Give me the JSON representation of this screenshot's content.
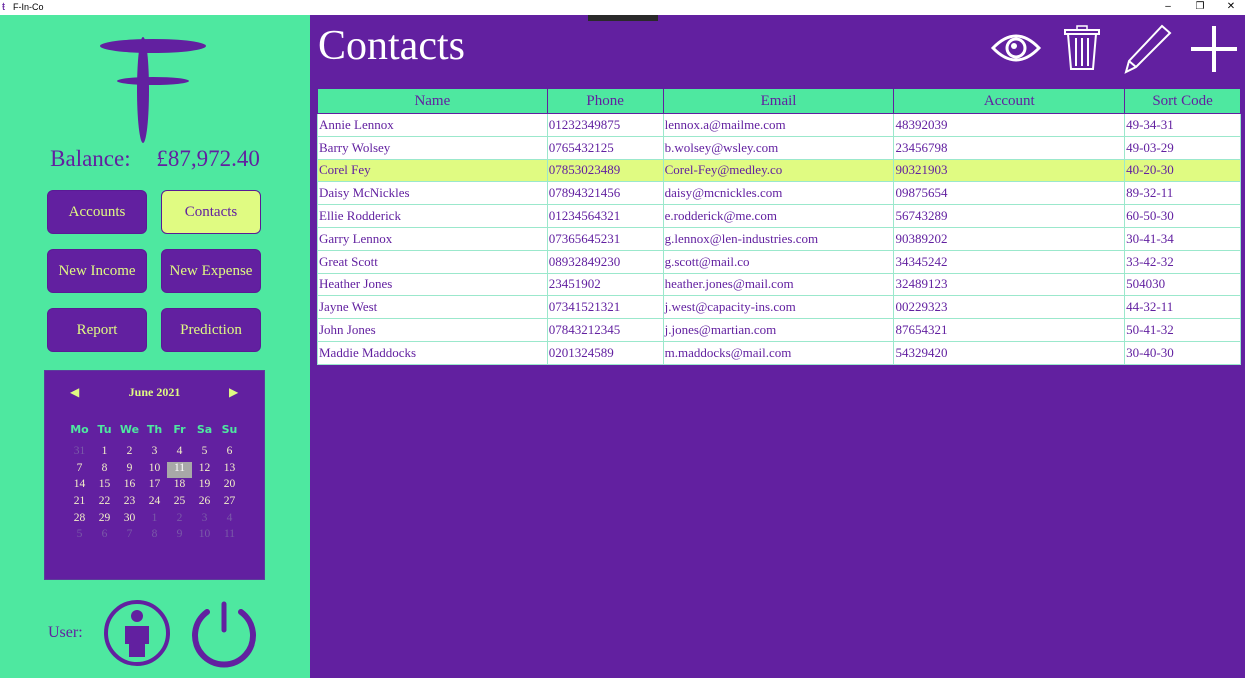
{
  "window": {
    "title": "F-In-Co"
  },
  "sidebar": {
    "balance_label": "Balance:",
    "balance_value": "£87,972.40",
    "buttons": [
      {
        "label": "Accounts",
        "active": false
      },
      {
        "label": "Contacts",
        "active": true
      },
      {
        "label": "New Income",
        "active": false
      },
      {
        "label": "New Expense",
        "active": false
      },
      {
        "label": "Report",
        "active": false
      },
      {
        "label": "Prediction",
        "active": false
      }
    ],
    "calendar": {
      "month": "June 2021",
      "days_of_week": [
        "Mo",
        "Tu",
        "We",
        "Th",
        "Fr",
        "Sa",
        "Su"
      ],
      "selected": "11",
      "weeks": [
        [
          "31",
          "1",
          "2",
          "3",
          "4",
          "5",
          "6"
        ],
        [
          "7",
          "8",
          "9",
          "10",
          "11",
          "12",
          "13"
        ],
        [
          "14",
          "15",
          "16",
          "17",
          "18",
          "19",
          "20"
        ],
        [
          "21",
          "22",
          "23",
          "24",
          "25",
          "26",
          "27"
        ],
        [
          "28",
          "29",
          "30",
          "1",
          "2",
          "3",
          "4"
        ],
        [
          "5",
          "6",
          "7",
          "8",
          "9",
          "10",
          "11"
        ]
      ]
    },
    "user_label": "User:"
  },
  "main": {
    "title": "Contacts",
    "toolbar": [
      "eye-icon",
      "trash-icon",
      "pencil-icon",
      "plus-icon"
    ],
    "columns": [
      "Name",
      "Phone",
      "Email",
      "Account",
      "Sort Code"
    ],
    "selected_row": 2,
    "rows": [
      [
        "Annie Lennox",
        "01232349875",
        "lennox.a@mailme.com",
        "48392039",
        "49-34-31"
      ],
      [
        "Barry Wolsey",
        "0765432125",
        "b.wolsey@wsley.com",
        "23456798",
        "49-03-29"
      ],
      [
        "Corel Fey",
        "07853023489",
        "Corel-Fey@medley.co",
        "90321903",
        "40-20-30"
      ],
      [
        "Daisy McNickles",
        "07894321456",
        "daisy@mcnickles.com",
        "09875654",
        "89-32-11"
      ],
      [
        "Ellie Rodderick",
        "01234564321",
        "e.rodderick@me.com",
        "56743289",
        "60-50-30"
      ],
      [
        "Garry Lennox",
        "07365645231",
        "g.lennox@len-industries.com",
        "90389202",
        "30-41-34"
      ],
      [
        "Great Scott",
        "08932849230",
        "g.scott@mail.co",
        "34345242",
        "33-42-32"
      ],
      [
        "Heather Jones",
        "23451902",
        "heather.jones@mail.com",
        "32489123",
        "504030"
      ],
      [
        "Jayne West",
        "07341521321",
        "j.west@capacity-ins.com",
        "00229323",
        "44-32-11"
      ],
      [
        "John Jones",
        "07843212345",
        "j.jones@martian.com",
        "87654321",
        "50-41-32"
      ],
      [
        "Maddie Maddocks",
        "0201324589",
        "m.maddocks@mail.com",
        "54329420",
        "30-40-30"
      ]
    ]
  },
  "colors": {
    "primary": "#6220a0",
    "secondary": "#4ee8a0",
    "accent": "#e0fb82"
  }
}
